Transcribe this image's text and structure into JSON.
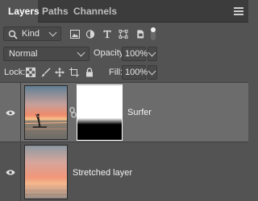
{
  "tabs": [
    {
      "label": "Layers",
      "active": true
    },
    {
      "label": "Paths",
      "active": false
    },
    {
      "label": "Channels",
      "active": false
    }
  ],
  "filter": {
    "kind_label": "Kind",
    "icons": [
      "image-filter-icon",
      "adjustment-filter-icon",
      "type-filter-icon",
      "shape-filter-icon",
      "smart-object-filter-icon"
    ]
  },
  "blend": {
    "mode": "Normal",
    "opacity_label": "Opacity:",
    "opacity_value": "100%"
  },
  "lock": {
    "label": "Lock:",
    "fill_label": "Fill:",
    "fill_value": "100%"
  },
  "layers": [
    {
      "name": "Surfer",
      "visible": true,
      "selected": true,
      "has_mask": true
    },
    {
      "name": "Stretched layer",
      "visible": true,
      "selected": false,
      "has_mask": false
    }
  ],
  "colors": {
    "panel_bg": "#535353",
    "selected_row": "#6c6c6c",
    "tab_bar": "#3c3c3c"
  }
}
